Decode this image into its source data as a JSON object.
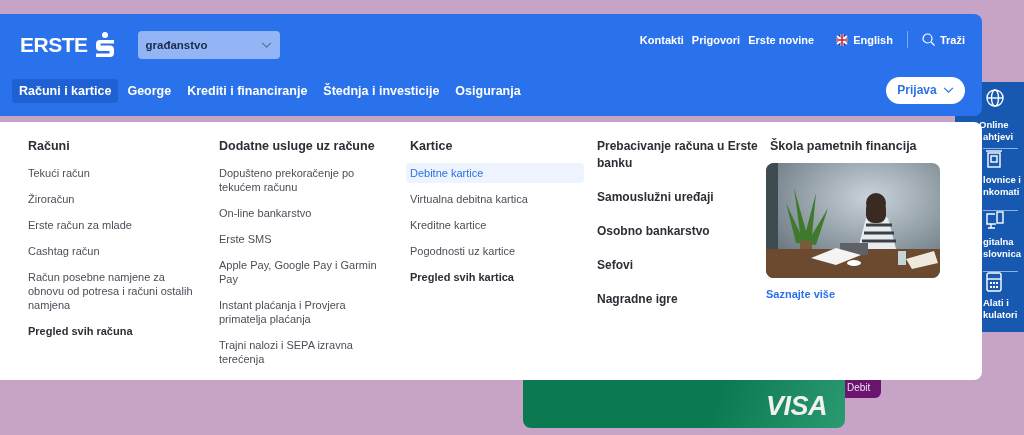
{
  "header": {
    "logo": "ERSTE",
    "segment_select": {
      "value": "građanstvo"
    },
    "top_links": [
      "Kontakti",
      "Prigovori",
      "Erste novine"
    ],
    "language": "English",
    "search": "Traži",
    "nav_tabs": [
      {
        "label": "Računi i kartice",
        "selected": true
      },
      {
        "label": "George",
        "selected": false
      },
      {
        "label": "Krediti i financiranje",
        "selected": false
      },
      {
        "label": "Štednja i investicije",
        "selected": false
      },
      {
        "label": "Osiguranja",
        "selected": false
      }
    ],
    "login_button": "Prijava"
  },
  "menu_columns": [
    {
      "kind": "list",
      "heading": "Računi",
      "items": [
        {
          "label": "Tekući račun",
          "kind": "link",
          "selected": false
        },
        {
          "label": "Žiroračun",
          "kind": "link",
          "selected": false
        },
        {
          "label": "Erste račun za mlade",
          "kind": "link",
          "selected": false
        },
        {
          "label": "Cashtag račun",
          "kind": "link",
          "selected": false
        },
        {
          "label": "Račun posebne namjene za obnovu od potresa i računi ostalih namjena",
          "kind": "link",
          "selected": false
        },
        {
          "label": "Pregled svih računa",
          "kind": "overview",
          "selected": false
        }
      ]
    },
    {
      "kind": "list",
      "heading": "Dodatne usluge uz račune",
      "items": [
        {
          "label": "Dopušteno prekoračenje po tekućem računu",
          "kind": "link",
          "selected": false
        },
        {
          "label": "On-line bankarstvo",
          "kind": "link",
          "selected": false
        },
        {
          "label": "Erste SMS",
          "kind": "link",
          "selected": false
        },
        {
          "label": "Apple Pay, Google Pay i Garmin Pay",
          "kind": "link",
          "selected": false
        },
        {
          "label": "Instant plaćanja i Provjera primatelja plaćanja",
          "kind": "link",
          "selected": false
        },
        {
          "label": "Trajni nalozi i SEPA izravna terećenja",
          "kind": "link",
          "selected": false
        }
      ]
    },
    {
      "kind": "list",
      "heading": "Kartice",
      "items": [
        {
          "label": "Debitne kartice",
          "kind": "link",
          "selected": true
        },
        {
          "label": "Virtualna debitna kartica",
          "kind": "link",
          "selected": false
        },
        {
          "label": "Kreditne kartice",
          "kind": "link",
          "selected": false
        },
        {
          "label": "Pogodnosti uz kartice",
          "kind": "link",
          "selected": false
        },
        {
          "label": "Pregled svih kartica",
          "kind": "overview",
          "selected": false
        }
      ]
    },
    {
      "kind": "major",
      "items": [
        "Prebacivanje računa u Erste banku",
        "Samouslužni uređaji",
        "Osobno bankarstvo",
        "Sefovi",
        "Nagradne igre"
      ]
    },
    {
      "kind": "promo",
      "heading": "Škola pametnih financija",
      "link": "Saznajte više"
    }
  ],
  "side_panel": [
    {
      "kind": "globe",
      "lines": [
        "Online",
        "ahtjevi"
      ]
    },
    {
      "kind": "atm",
      "lines": [
        "lovnice i",
        "nkomati"
      ]
    },
    {
      "kind": "monitor",
      "lines": [
        "gitalna",
        "slovnica"
      ]
    },
    {
      "kind": "calculator",
      "lines": [
        "Alati i",
        "kulatori"
      ]
    }
  ],
  "background_card": {
    "brand": "VISA",
    "tab": "Debit"
  }
}
